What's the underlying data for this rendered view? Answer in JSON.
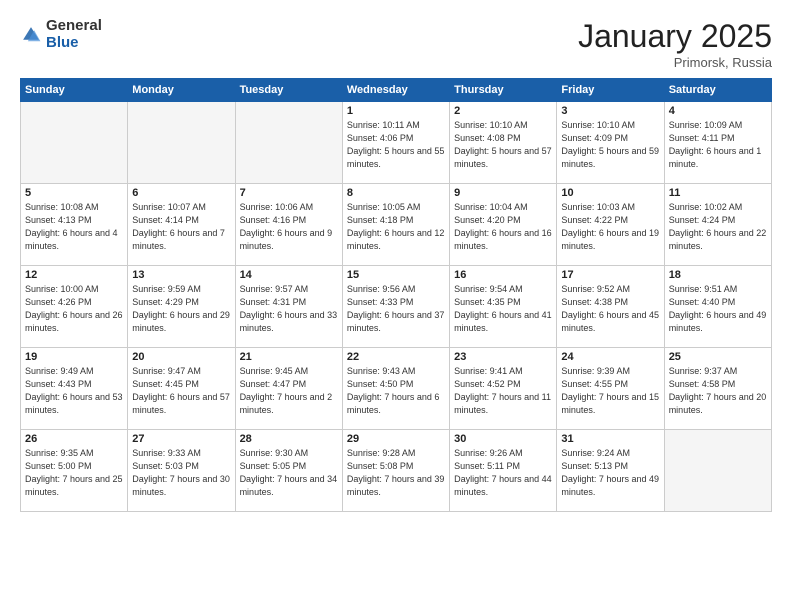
{
  "logo": {
    "general": "General",
    "blue": "Blue"
  },
  "title": "January 2025",
  "location": "Primorsk, Russia",
  "headers": [
    "Sunday",
    "Monday",
    "Tuesday",
    "Wednesday",
    "Thursday",
    "Friday",
    "Saturday"
  ],
  "weeks": [
    [
      {
        "day": "",
        "detail": ""
      },
      {
        "day": "",
        "detail": ""
      },
      {
        "day": "",
        "detail": ""
      },
      {
        "day": "1",
        "detail": "Sunrise: 10:11 AM\nSunset: 4:06 PM\nDaylight: 5 hours\nand 55 minutes."
      },
      {
        "day": "2",
        "detail": "Sunrise: 10:10 AM\nSunset: 4:08 PM\nDaylight: 5 hours\nand 57 minutes."
      },
      {
        "day": "3",
        "detail": "Sunrise: 10:10 AM\nSunset: 4:09 PM\nDaylight: 5 hours\nand 59 minutes."
      },
      {
        "day": "4",
        "detail": "Sunrise: 10:09 AM\nSunset: 4:11 PM\nDaylight: 6 hours\nand 1 minute."
      }
    ],
    [
      {
        "day": "5",
        "detail": "Sunrise: 10:08 AM\nSunset: 4:13 PM\nDaylight: 6 hours\nand 4 minutes."
      },
      {
        "day": "6",
        "detail": "Sunrise: 10:07 AM\nSunset: 4:14 PM\nDaylight: 6 hours\nand 7 minutes."
      },
      {
        "day": "7",
        "detail": "Sunrise: 10:06 AM\nSunset: 4:16 PM\nDaylight: 6 hours\nand 9 minutes."
      },
      {
        "day": "8",
        "detail": "Sunrise: 10:05 AM\nSunset: 4:18 PM\nDaylight: 6 hours\nand 12 minutes."
      },
      {
        "day": "9",
        "detail": "Sunrise: 10:04 AM\nSunset: 4:20 PM\nDaylight: 6 hours\nand 16 minutes."
      },
      {
        "day": "10",
        "detail": "Sunrise: 10:03 AM\nSunset: 4:22 PM\nDaylight: 6 hours\nand 19 minutes."
      },
      {
        "day": "11",
        "detail": "Sunrise: 10:02 AM\nSunset: 4:24 PM\nDaylight: 6 hours\nand 22 minutes."
      }
    ],
    [
      {
        "day": "12",
        "detail": "Sunrise: 10:00 AM\nSunset: 4:26 PM\nDaylight: 6 hours\nand 26 minutes."
      },
      {
        "day": "13",
        "detail": "Sunrise: 9:59 AM\nSunset: 4:29 PM\nDaylight: 6 hours\nand 29 minutes."
      },
      {
        "day": "14",
        "detail": "Sunrise: 9:57 AM\nSunset: 4:31 PM\nDaylight: 6 hours\nand 33 minutes."
      },
      {
        "day": "15",
        "detail": "Sunrise: 9:56 AM\nSunset: 4:33 PM\nDaylight: 6 hours\nand 37 minutes."
      },
      {
        "day": "16",
        "detail": "Sunrise: 9:54 AM\nSunset: 4:35 PM\nDaylight: 6 hours\nand 41 minutes."
      },
      {
        "day": "17",
        "detail": "Sunrise: 9:52 AM\nSunset: 4:38 PM\nDaylight: 6 hours\nand 45 minutes."
      },
      {
        "day": "18",
        "detail": "Sunrise: 9:51 AM\nSunset: 4:40 PM\nDaylight: 6 hours\nand 49 minutes."
      }
    ],
    [
      {
        "day": "19",
        "detail": "Sunrise: 9:49 AM\nSunset: 4:43 PM\nDaylight: 6 hours\nand 53 minutes."
      },
      {
        "day": "20",
        "detail": "Sunrise: 9:47 AM\nSunset: 4:45 PM\nDaylight: 6 hours\nand 57 minutes."
      },
      {
        "day": "21",
        "detail": "Sunrise: 9:45 AM\nSunset: 4:47 PM\nDaylight: 7 hours\nand 2 minutes."
      },
      {
        "day": "22",
        "detail": "Sunrise: 9:43 AM\nSunset: 4:50 PM\nDaylight: 7 hours\nand 6 minutes."
      },
      {
        "day": "23",
        "detail": "Sunrise: 9:41 AM\nSunset: 4:52 PM\nDaylight: 7 hours\nand 11 minutes."
      },
      {
        "day": "24",
        "detail": "Sunrise: 9:39 AM\nSunset: 4:55 PM\nDaylight: 7 hours\nand 15 minutes."
      },
      {
        "day": "25",
        "detail": "Sunrise: 9:37 AM\nSunset: 4:58 PM\nDaylight: 7 hours\nand 20 minutes."
      }
    ],
    [
      {
        "day": "26",
        "detail": "Sunrise: 9:35 AM\nSunset: 5:00 PM\nDaylight: 7 hours\nand 25 minutes."
      },
      {
        "day": "27",
        "detail": "Sunrise: 9:33 AM\nSunset: 5:03 PM\nDaylight: 7 hours\nand 30 minutes."
      },
      {
        "day": "28",
        "detail": "Sunrise: 9:30 AM\nSunset: 5:05 PM\nDaylight: 7 hours\nand 34 minutes."
      },
      {
        "day": "29",
        "detail": "Sunrise: 9:28 AM\nSunset: 5:08 PM\nDaylight: 7 hours\nand 39 minutes."
      },
      {
        "day": "30",
        "detail": "Sunrise: 9:26 AM\nSunset: 5:11 PM\nDaylight: 7 hours\nand 44 minutes."
      },
      {
        "day": "31",
        "detail": "Sunrise: 9:24 AM\nSunset: 5:13 PM\nDaylight: 7 hours\nand 49 minutes."
      },
      {
        "day": "",
        "detail": ""
      }
    ]
  ]
}
